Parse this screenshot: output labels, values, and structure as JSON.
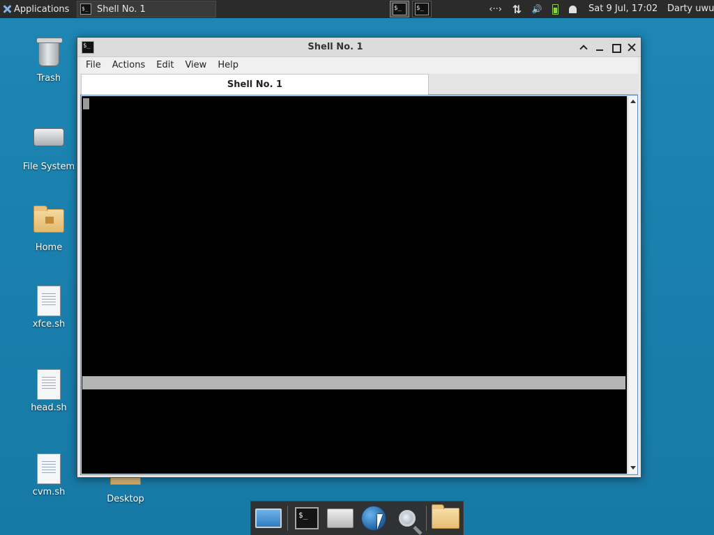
{
  "top_panel": {
    "apps_menu_label": "Applications",
    "task_title": "Shell No. 1",
    "clock": "Sat  9 Jul, 17:02",
    "user": "Darty uwu",
    "tray": {
      "network_glyph": "‹··›",
      "transfer_glyph": "⇅",
      "volume_glyph": "🔊"
    }
  },
  "desktop": {
    "icons": [
      {
        "label": "Trash",
        "icon": "trash-icon"
      },
      {
        "label": "File System",
        "icon": "drive-icon"
      },
      {
        "label": "Home",
        "icon": "home-folder-icon"
      },
      {
        "label": "xfce.sh",
        "icon": "script-file-icon"
      },
      {
        "label": "head.sh",
        "icon": "script-file-icon"
      },
      {
        "label": "cvm.sh",
        "icon": "script-file-icon"
      },
      {
        "label": "Desktop",
        "icon": "folder-icon"
      }
    ]
  },
  "window": {
    "title": "Shell No. 1",
    "menu": [
      "File",
      "Actions",
      "Edit",
      "View",
      "Help"
    ],
    "tab_title": "Shell No. 1"
  },
  "dock": {
    "items": [
      "show-desktop-icon",
      "terminal-icon",
      "file-manager-icon",
      "web-browser-icon",
      "search-icon",
      "folder-icon"
    ]
  },
  "colors": {
    "desktop_bg": "#1e87b5",
    "panel_bg": "#2b2b2b",
    "terminal_bg": "#000000",
    "selection_line": "#b4b4b4"
  }
}
